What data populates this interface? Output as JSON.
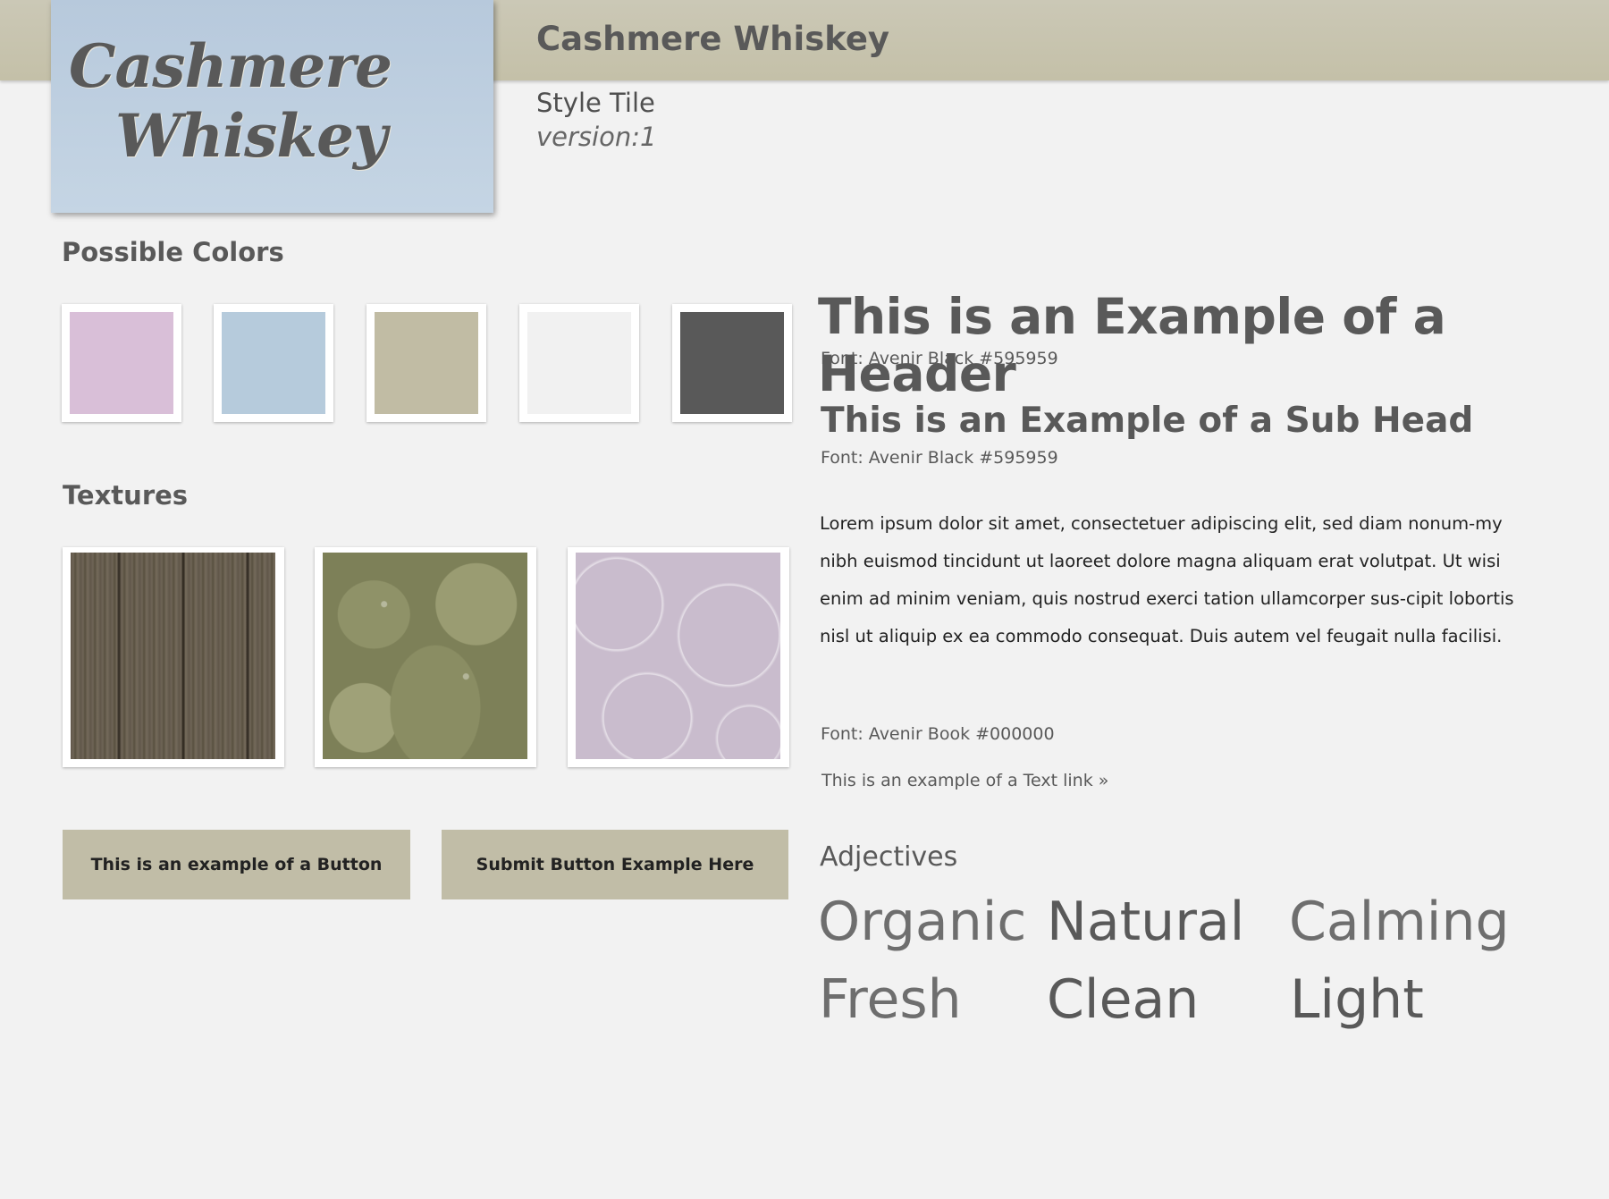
{
  "header": {
    "logo_line1": "Cashmere",
    "logo_line2": "Whiskey",
    "title": "Cashmere Whiskey",
    "subtitle": "Style Tile",
    "version": "version:1"
  },
  "colors": {
    "title": "Possible Colors",
    "swatches": [
      "#d9bfd8",
      "#b6cbdc",
      "#c1bca4",
      "#f1f1f1",
      "#595959"
    ]
  },
  "textures": {
    "title": "Textures",
    "items": [
      "wood-texture",
      "leaves-texture",
      "bubbles-texture"
    ]
  },
  "buttons": {
    "button1": "This is an example of a Button",
    "button2": "Submit Button Example Here"
  },
  "typography": {
    "header_example": "This is an Example of a Header",
    "header_font": "Font: Avenir Black #595959",
    "subhead_example": "This is an Example of a Sub Head",
    "subhead_font": "Font: Avenir Black #595959",
    "body_example": "Lorem ipsum dolor sit amet, consectetuer adipiscing elit, sed diam nonum-my nibh euismod tincidunt ut laoreet dolore magna aliquam erat volutpat. Ut wisi enim ad minim veniam, quis nostrud exerci tation ullamcorper sus-cipit lobortis nisl ut aliquip ex ea commodo consequat. Duis autem vel feugait nulla facilisi.",
    "body_font": "Font: Avenir Book #000000",
    "text_link": "This is an example of a Text link »"
  },
  "adjectives": {
    "title": "Adjectives",
    "words": [
      "Organic",
      "Natural",
      "Calming",
      "Fresh",
      "Clean",
      "Light"
    ]
  }
}
